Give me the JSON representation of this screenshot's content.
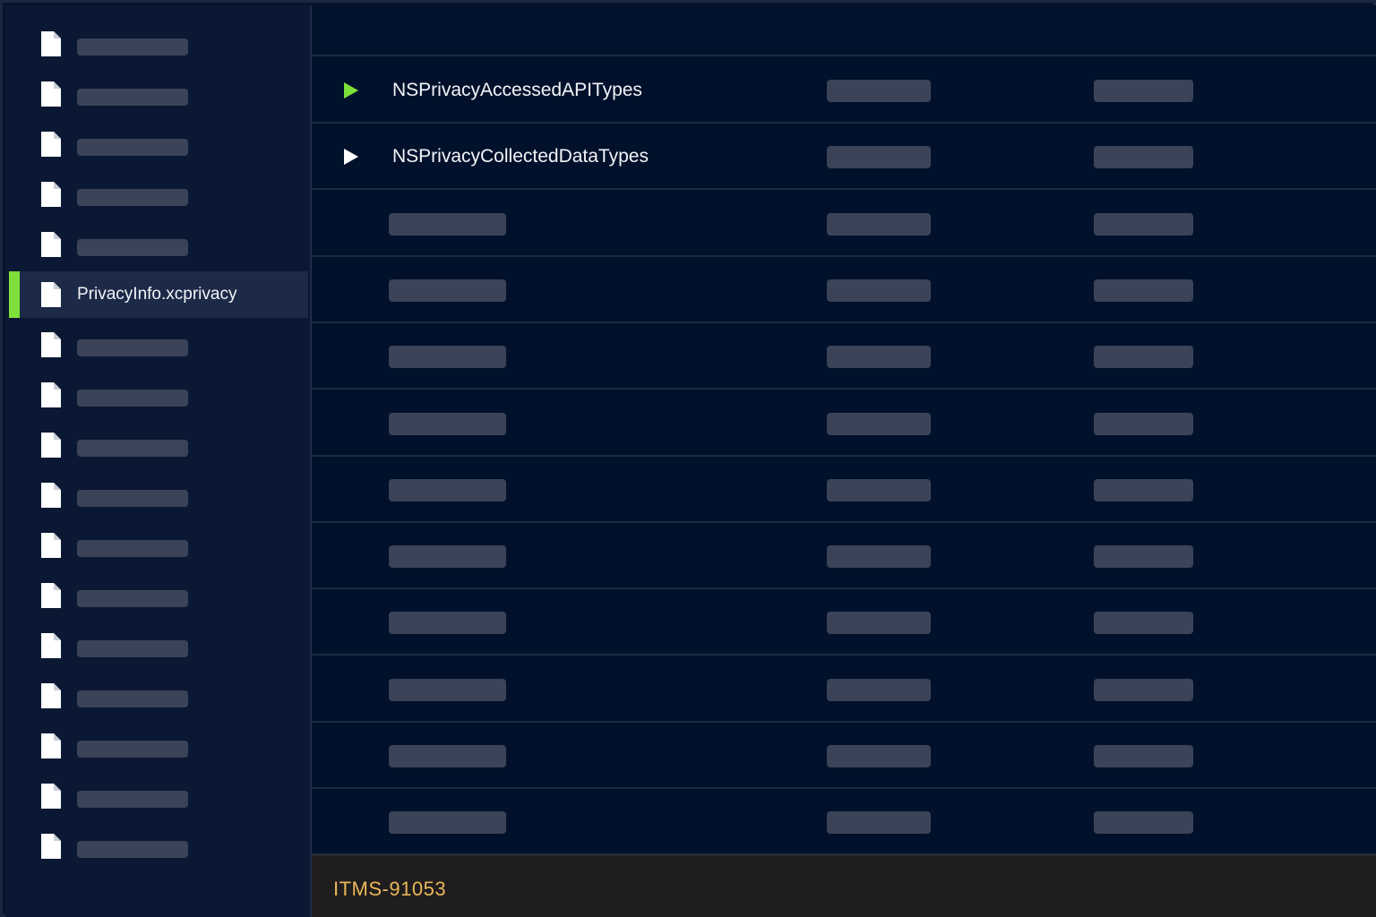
{
  "sidebar": {
    "items": [
      {
        "label": "",
        "placeholder": true
      },
      {
        "label": "",
        "placeholder": true
      },
      {
        "label": "",
        "placeholder": true
      },
      {
        "label": "",
        "placeholder": true
      },
      {
        "label": "",
        "placeholder": true
      },
      {
        "label": "PrivacyInfo.xcprivacy",
        "placeholder": false,
        "selected": true
      },
      {
        "label": "",
        "placeholder": true
      },
      {
        "label": "",
        "placeholder": true
      },
      {
        "label": "",
        "placeholder": true
      },
      {
        "label": "",
        "placeholder": true
      },
      {
        "label": "",
        "placeholder": true
      },
      {
        "label": "",
        "placeholder": true
      },
      {
        "label": "",
        "placeholder": true
      },
      {
        "label": "",
        "placeholder": true
      },
      {
        "label": "",
        "placeholder": true
      },
      {
        "label": "",
        "placeholder": true
      },
      {
        "label": "",
        "placeholder": true
      }
    ]
  },
  "plist": {
    "rows": [
      {
        "key": "NSPrivacyAccessedAPITypes",
        "toggle": "triangle-right",
        "toggle_color": "#7ee03a"
      },
      {
        "key": "NSPrivacyCollectedDataTypes",
        "toggle": "triangle-right",
        "toggle_color": "#ffffff"
      },
      {
        "key": "",
        "placeholder": true
      },
      {
        "key": "",
        "placeholder": true
      },
      {
        "key": "",
        "placeholder": true
      },
      {
        "key": "",
        "placeholder": true
      },
      {
        "key": "",
        "placeholder": true
      },
      {
        "key": "",
        "placeholder": true
      },
      {
        "key": "",
        "placeholder": true
      },
      {
        "key": "",
        "placeholder": true
      },
      {
        "key": "",
        "placeholder": true
      },
      {
        "key": "",
        "placeholder": true
      }
    ]
  },
  "footer": {
    "code": "ITMS-91053"
  },
  "colors": {
    "accent": "#7ee03a",
    "warning": "#e9b756",
    "background": "#02112b",
    "placeholder": "#3a4358"
  }
}
